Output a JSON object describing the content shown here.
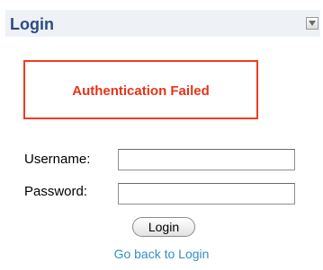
{
  "header": {
    "title": "Login",
    "toggle_icon": "triangle-down-icon"
  },
  "error": {
    "message": "Authentication Failed",
    "color": "#e8321a"
  },
  "form": {
    "username_label": "Username:",
    "username_value": "",
    "password_label": "Password:",
    "password_value": "",
    "submit_label": "Login"
  },
  "links": {
    "back_label": "Go back to Login",
    "link_color": "#2f8fc8"
  },
  "colors": {
    "header_bg": "#eef2f7",
    "title_color": "#2c4a85",
    "error_border": "#f03c1e"
  }
}
